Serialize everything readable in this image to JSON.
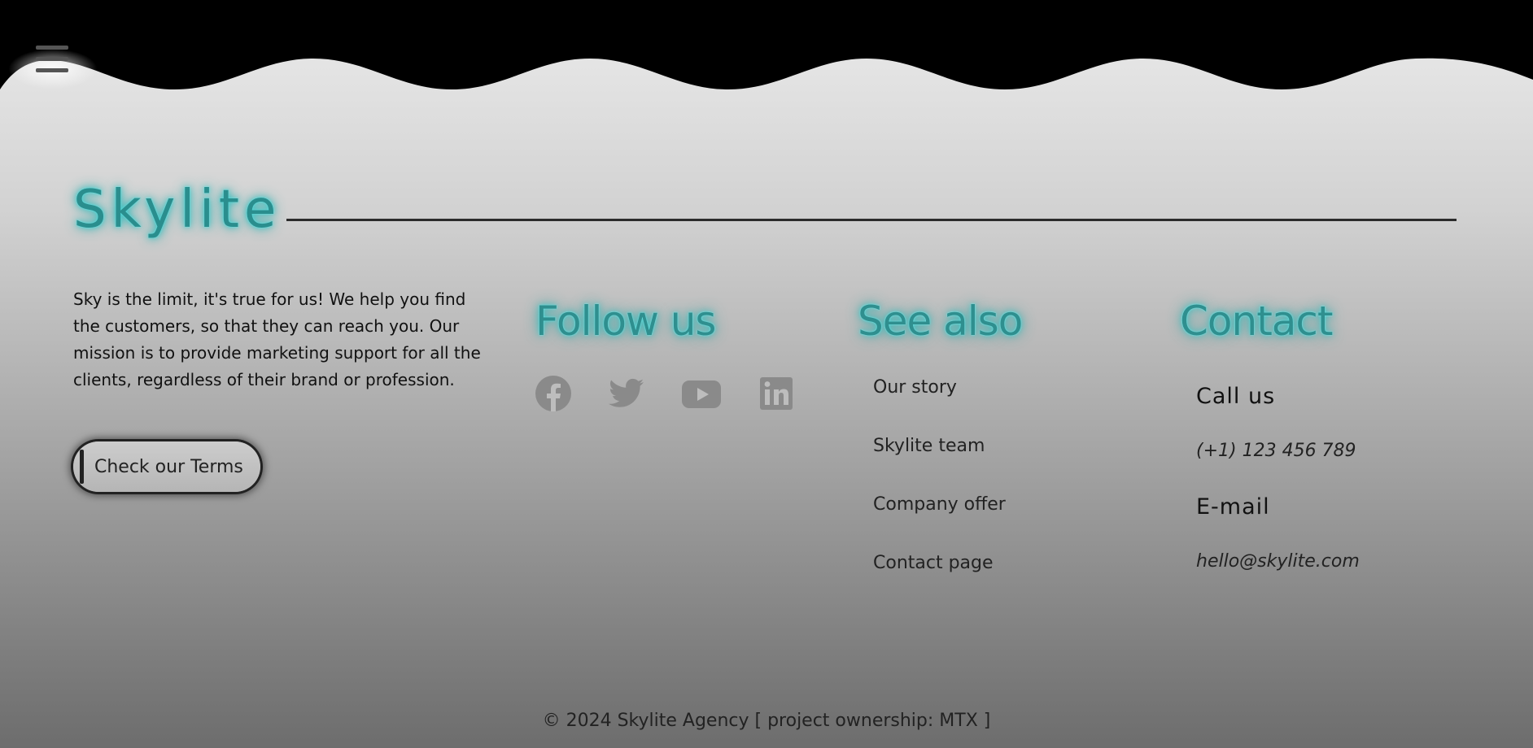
{
  "brand": {
    "name": "Skylite",
    "accent": "#33c6c6"
  },
  "about": {
    "text": "Sky is the limit, it's true for us! We help you find the customers, so that they can reach you. Our mission is to provide marketing support for all the clients, regardless of their brand or profession."
  },
  "terms_button": {
    "label": "Check our Terms"
  },
  "follow": {
    "title": "Follow us",
    "icons": [
      "facebook-icon",
      "twitter-icon",
      "youtube-icon",
      "linkedin-icon"
    ]
  },
  "see_also": {
    "title": "See also",
    "links": [
      {
        "label": "Our story"
      },
      {
        "label": "Skylite team"
      },
      {
        "label": "Company offer"
      },
      {
        "label": "Contact page"
      }
    ]
  },
  "contact": {
    "title": "Contact",
    "call_label": "Call us",
    "phone": "(+1) 123 456 789",
    "email_label": "E-mail",
    "email": "hello@skylite.com"
  },
  "footer": {
    "copyright": "© 2024 Skylite Agency [ project ownership: MTX ]"
  },
  "menu": {
    "icon": "hamburger-icon"
  }
}
